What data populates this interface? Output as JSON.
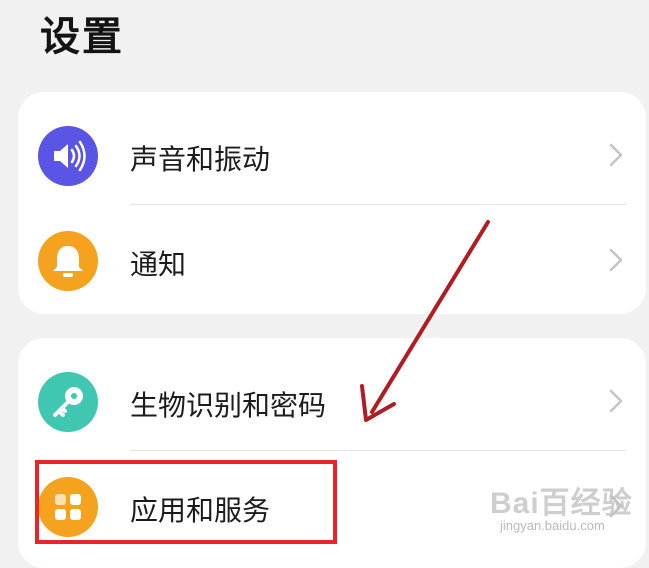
{
  "header": {
    "title": "设置"
  },
  "groups": [
    {
      "items": [
        {
          "label": "声音和振动",
          "icon": "speaker-icon",
          "color": "#5b55e6"
        },
        {
          "label": "通知",
          "icon": "bell-icon",
          "color": "#f5a31e"
        }
      ]
    },
    {
      "items": [
        {
          "label": "生物识别和密码",
          "icon": "key-icon",
          "color": "#3fc7b1"
        },
        {
          "label": "应用和服务",
          "icon": "apps-grid-icon",
          "color": "#f5a31e"
        }
      ]
    }
  ],
  "annotation": {
    "highlight_color": "#e8232b",
    "arrow_color": "#b01c22",
    "highlighted_item": "应用和服务"
  },
  "watermark": {
    "brand": "Bai百经验",
    "url": "jingyan.baidu.com"
  }
}
